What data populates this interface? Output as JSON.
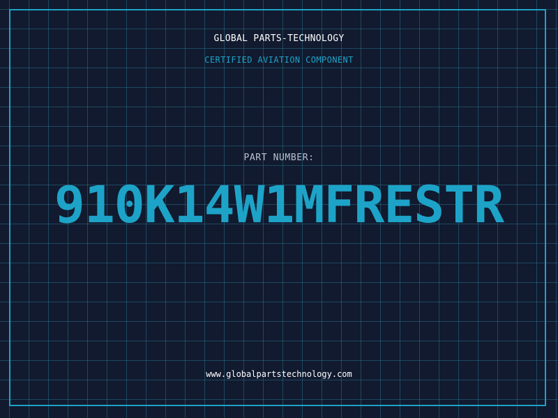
{
  "header": {
    "company": "GLOBAL PARTS-TECHNOLOGY",
    "tagline": "CERTIFIED AVIATION COMPONENT"
  },
  "part": {
    "label": "PART NUMBER:",
    "number": "910K14W1MFRESTR"
  },
  "footer": {
    "website": "www.globalpartstechnology.com"
  },
  "colors": {
    "background": "#111a2e",
    "accent": "#1ea3c8",
    "grid": "#286e8c",
    "text": "#ffffff"
  }
}
